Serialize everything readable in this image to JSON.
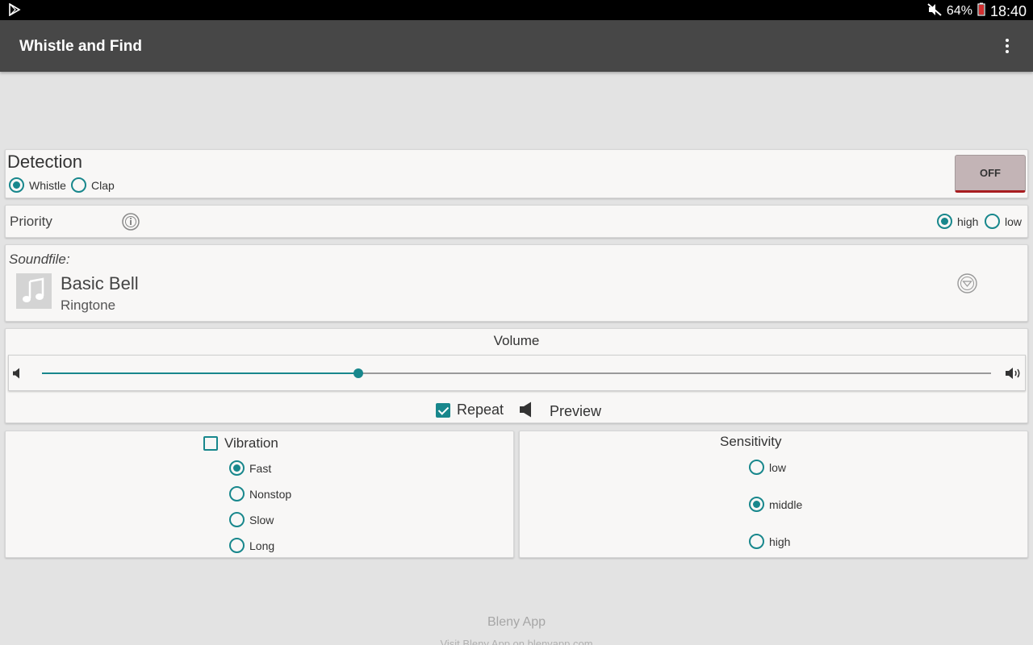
{
  "status_bar": {
    "battery": "64%",
    "time": "18:40",
    "icons": [
      "play-store-icon",
      "mute-icon",
      "battery-icon"
    ]
  },
  "app_bar": {
    "title": "Whistle and Find",
    "menu_icon": "overflow-menu-icon"
  },
  "detection": {
    "title": "Detection",
    "options": [
      {
        "label": "Whistle",
        "selected": true
      },
      {
        "label": "Clap",
        "selected": false
      }
    ],
    "toggle_label": "OFF"
  },
  "priority": {
    "label": "Priority",
    "info_icon": "info-icon",
    "options": [
      {
        "label": "high",
        "selected": true
      },
      {
        "label": "low",
        "selected": false
      }
    ]
  },
  "soundfile": {
    "label": "Soundfile:",
    "name": "Basic Bell",
    "type": "Ringtone",
    "icon": "music-note-icon",
    "dropdown_icon": "dropdown-circle-icon"
  },
  "volume": {
    "label": "Volume",
    "value_percent": 33,
    "repeat_label": "Repeat",
    "repeat_checked": true,
    "preview_label": "Preview"
  },
  "vibration": {
    "label": "Vibration",
    "checked": false,
    "options": [
      {
        "label": "Fast",
        "selected": true
      },
      {
        "label": "Nonstop",
        "selected": false
      },
      {
        "label": "Slow",
        "selected": false
      },
      {
        "label": "Long",
        "selected": false
      }
    ]
  },
  "sensitivity": {
    "label": "Sensitivity",
    "options": [
      {
        "label": "low",
        "selected": false
      },
      {
        "label": "middle",
        "selected": true
      },
      {
        "label": "high",
        "selected": false
      }
    ]
  },
  "footer": {
    "brand": "Bleny App",
    "link_text": "Visit Bleny App on blenyapp.com"
  },
  "colors": {
    "accent": "#18878c",
    "app_bar": "#474747",
    "toggle_off": "#c3b4b6"
  }
}
